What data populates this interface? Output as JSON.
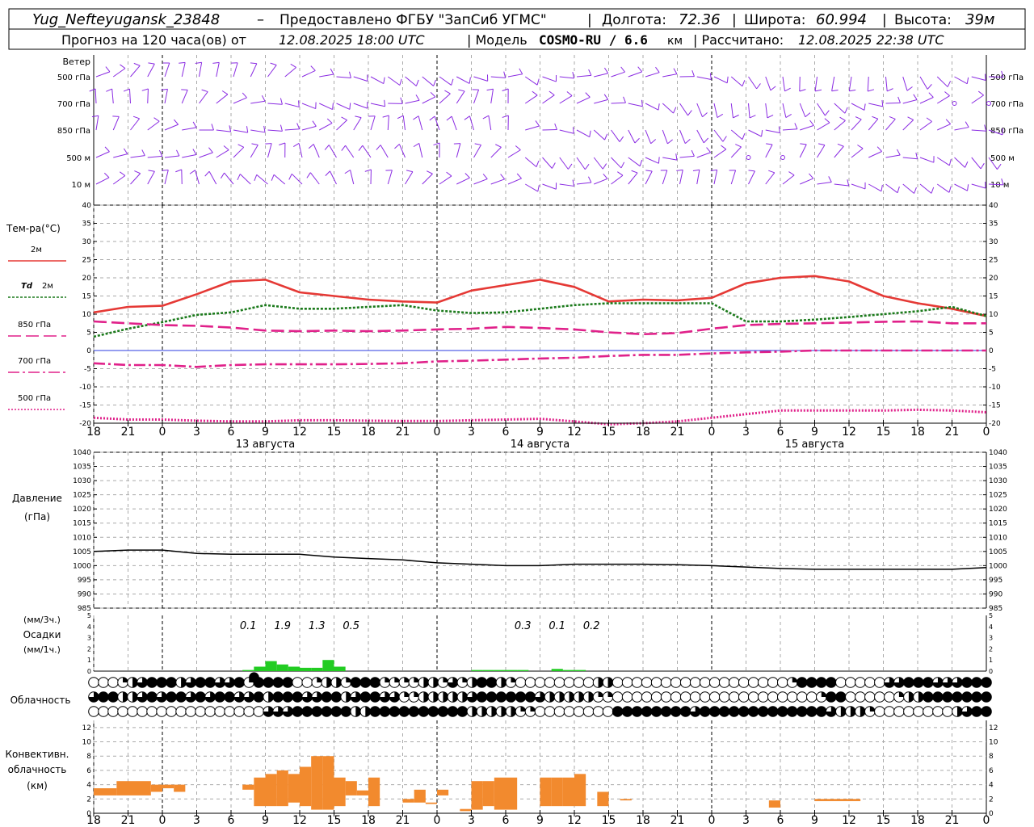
{
  "header": {
    "station": "Yug_Nefteyugansk_23848",
    "dash": "–",
    "provider": "Предоставлено ФГБУ \"ЗапСиб УГМС\"",
    "lon_label": "Долгота:",
    "lon": "72.36",
    "lat_label": "Широта:",
    "lat": "60.994",
    "alt_label": "Высота:",
    "alt": "39м",
    "forecast_label": "Прогноз на 120 часа(ов) от",
    "forecast_from": "12.08.2025 18:00 UTC",
    "model_label": "| Модель",
    "model": "COSMO-RU / 6.6",
    "model_unit": "км",
    "calc_label": "| Рассчитано:",
    "calc_time": "12.08.2025 22:38 UTC"
  },
  "time_axis": {
    "hour_labels": [
      "18",
      "21",
      "0",
      "3",
      "6",
      "9",
      "12",
      "15",
      "18",
      "21",
      "0",
      "3",
      "6",
      "9",
      "12",
      "15",
      "18",
      "21",
      "0",
      "3",
      "6",
      "9",
      "12",
      "15",
      "18",
      "21",
      "0"
    ],
    "day_labels": [
      {
        "label": "13 августа",
        "at_hour": 15
      },
      {
        "label": "14 августа",
        "at_hour": 39
      },
      {
        "label": "15 августа",
        "at_hour": 63
      }
    ],
    "day_boundaries_hours": [
      6,
      30,
      54,
      78
    ]
  },
  "wind_panel": {
    "title": "Ветер",
    "levels": [
      "500 гПа",
      "700 гПа",
      "850 гПа",
      "500 м",
      "10  м"
    ],
    "color": "#8a2be2"
  },
  "temperature": {
    "chart_data": {
      "type": "line",
      "title": "Тем-ра(°С)",
      "x": [
        0,
        3,
        6,
        9,
        12,
        15,
        18,
        21,
        24,
        27,
        30,
        33,
        36,
        39,
        42,
        45,
        48,
        51,
        54,
        57,
        60,
        63,
        66,
        69,
        72,
        75,
        78
      ],
      "ylim": [
        -20,
        40
      ],
      "yticks": [
        -20,
        -15,
        -10,
        -5,
        0,
        5,
        10,
        15,
        20,
        25,
        30,
        35,
        40
      ],
      "series": [
        {
          "name": "2м",
          "color": "#e53935",
          "dash": "",
          "values": [
            10.5,
            12,
            12.3,
            15.5,
            19,
            19.5,
            16,
            15,
            14,
            13.5,
            13.2,
            16.5,
            18,
            19.5,
            17.5,
            13.5,
            14,
            13.8,
            14.5,
            18.5,
            20,
            20.5,
            19,
            15,
            13,
            11.5,
            9.5
          ]
        },
        {
          "name": "Td 2м",
          "color": "#1b7a1b",
          "dash": "3,2",
          "values": [
            3.8,
            6,
            7.8,
            9.8,
            10.5,
            12.5,
            11.5,
            11.5,
            12,
            12.5,
            11,
            10.3,
            10.5,
            11.5,
            12.5,
            13,
            13,
            13,
            13,
            8,
            8,
            8.5,
            9.2,
            10,
            10.8,
            12,
            9.5
          ]
        },
        {
          "name": "850 гПа",
          "color": "#e0218a",
          "dash": "16,6",
          "values": [
            8,
            7.5,
            7,
            6.8,
            6.3,
            5.5,
            5.3,
            5.5,
            5.3,
            5.5,
            5.8,
            6,
            6.5,
            6.2,
            5.8,
            5,
            4.5,
            4.8,
            6,
            7,
            7.3,
            7.5,
            7.7,
            7.9,
            8,
            7.5,
            7.5
          ]
        },
        {
          "name": "700 гПа",
          "color": "#e0218a",
          "dash": "14,4,3,4",
          "values": [
            -3.5,
            -4,
            -4,
            -4.5,
            -4,
            -3.8,
            -3.8,
            -3.8,
            -3.7,
            -3.5,
            -3,
            -2.8,
            -2.5,
            -2.2,
            -2,
            -1.5,
            -1.2,
            -1.2,
            -0.8,
            -0.5,
            -0.3,
            0,
            0,
            0,
            0,
            0,
            0
          ]
        },
        {
          "name": "500 гПа",
          "color": "#e0218a",
          "dash": "2,2",
          "values": [
            -18.5,
            -19,
            -19,
            -19.3,
            -19.5,
            -19.5,
            -19.2,
            -19.2,
            -19.3,
            -19.4,
            -19.4,
            -19.2,
            -19,
            -18.8,
            -19.5,
            -20.3,
            -20,
            -19.5,
            -18.5,
            -17.5,
            -16.5,
            -16.5,
            -16.5,
            -16.5,
            -16.3,
            -16.5,
            -17
          ]
        }
      ],
      "zero_line_color": "#2b3be0"
    }
  },
  "pressure": {
    "title_line1": "Давление",
    "title_line2": "(гПа)",
    "chart_data": {
      "type": "line",
      "x": [
        0,
        3,
        6,
        9,
        12,
        15,
        18,
        21,
        24,
        27,
        30,
        33,
        36,
        39,
        42,
        45,
        48,
        51,
        54,
        57,
        60,
        63,
        66,
        69,
        72,
        75,
        78
      ],
      "ylim": [
        985,
        1040
      ],
      "yticks": [
        985,
        990,
        995,
        1000,
        1005,
        1010,
        1015,
        1020,
        1025,
        1030,
        1035,
        1040
      ],
      "series": [
        {
          "name": "",
          "color": "#000000",
          "values": [
            1005,
            1005.5,
            1005.5,
            1004.3,
            1004,
            1004,
            1004,
            1003,
            1002.5,
            1002,
            1001,
            1000.5,
            1000,
            1000,
            1000.5,
            1000.5,
            1000.5,
            1000.3,
            1000,
            999.5,
            999,
            998.7,
            998.7,
            998.7,
            998.7,
            998.7,
            999.3
          ]
        }
      ]
    }
  },
  "precipitation": {
    "title_line1": "(мм/3ч.)",
    "title_line2": "Осадки",
    "title_line3": "(мм/1ч.)",
    "totals": [
      {
        "label": "0.1",
        "at_hour": 13.5
      },
      {
        "label": "1.9",
        "at_hour": 16.5
      },
      {
        "label": "1.3",
        "at_hour": 19.5
      },
      {
        "label": "0.5",
        "at_hour": 22.5
      },
      {
        "label": "0.3",
        "at_hour": 37.5
      },
      {
        "label": "0.1",
        "at_hour": 40.5
      },
      {
        "label": "0.2",
        "at_hour": 43.5
      }
    ],
    "chart_data": {
      "type": "bar",
      "ylim": [
        0,
        5
      ],
      "yticks": [
        0,
        1,
        2,
        3,
        4,
        5
      ],
      "color": "#22cc22",
      "hours": [
        13,
        14,
        15,
        16,
        17,
        18,
        19,
        20,
        21,
        22,
        33,
        34,
        35,
        36,
        37,
        38,
        40,
        41,
        42
      ],
      "values": [
        0.1,
        0.4,
        0.9,
        0.6,
        0.4,
        0.3,
        0.3,
        1.0,
        0.4,
        0,
        0.1,
        0.1,
        0.1,
        0.1,
        0.1,
        0,
        0.2,
        0.1,
        0.1
      ]
    }
  },
  "cloudiness": {
    "title": "Облачность",
    "rows": [
      "000123444234433454444001221444111122131244210000000022000000000000000000144440000033444333444",
      "344223434434344334244433442344331122222344444432222211000000000000000000000144000001224444444",
      "000000000000000000333444444224444444444222221100000000444444443444444444444432221000000002344"
    ]
  },
  "convective": {
    "title_line1": "Конвективн.",
    "title_line2": "облачность",
    "title_line3": "(км)",
    "chart_data": {
      "type": "bar",
      "ylim": [
        0,
        13
      ],
      "yticks": [
        0,
        2,
        4,
        6,
        8,
        10,
        12
      ],
      "color": "#f28a2e",
      "segments": [
        {
          "h0": 0,
          "h1": 2,
          "base": 2.5,
          "top": 3.5
        },
        {
          "h0": 2,
          "h1": 5,
          "base": 2.5,
          "top": 4.5
        },
        {
          "h0": 5,
          "h1": 6,
          "base": 3,
          "top": 4
        },
        {
          "h0": 6,
          "h1": 7,
          "base": 3.5,
          "top": 4
        },
        {
          "h0": 7,
          "h1": 8,
          "base": 3,
          "top": 4
        },
        {
          "h0": 13,
          "h1": 14,
          "base": 3.3,
          "top": 4
        },
        {
          "h0": 14,
          "h1": 15,
          "base": 1,
          "top": 5
        },
        {
          "h0": 15,
          "h1": 16,
          "base": 1,
          "top": 5.5
        },
        {
          "h0": 16,
          "h1": 17,
          "base": 1,
          "top": 6
        },
        {
          "h0": 17,
          "h1": 18,
          "base": 1.5,
          "top": 5.5
        },
        {
          "h0": 18,
          "h1": 19,
          "base": 1,
          "top": 6.5
        },
        {
          "h0": 19,
          "h1": 20,
          "base": 0.5,
          "top": 8
        },
        {
          "h0": 20,
          "h1": 21,
          "base": 0.5,
          "top": 8
        },
        {
          "h0": 21,
          "h1": 22,
          "base": 1,
          "top": 5
        },
        {
          "h0": 22,
          "h1": 23,
          "base": 2.5,
          "top": 4.5
        },
        {
          "h0": 23,
          "h1": 24,
          "base": 2.5,
          "top": 3.2
        },
        {
          "h0": 24,
          "h1": 25,
          "base": 1,
          "top": 5
        },
        {
          "h0": 27,
          "h1": 28,
          "base": 1.5,
          "top": 2
        },
        {
          "h0": 28,
          "h1": 29,
          "base": 1.5,
          "top": 3.3
        },
        {
          "h0": 29,
          "h1": 30,
          "base": 1.3,
          "top": 1.5
        },
        {
          "h0": 30,
          "h1": 31,
          "base": 2.5,
          "top": 3.3
        },
        {
          "h0": 32,
          "h1": 33,
          "base": 0.3,
          "top": 0.6
        },
        {
          "h0": 33,
          "h1": 34,
          "base": 0.5,
          "top": 4.5
        },
        {
          "h0": 34,
          "h1": 35,
          "base": 1,
          "top": 4.5
        },
        {
          "h0": 35,
          "h1": 36,
          "base": 0.5,
          "top": 5
        },
        {
          "h0": 36,
          "h1": 37,
          "base": 0.5,
          "top": 5
        },
        {
          "h0": 39,
          "h1": 40,
          "base": 1,
          "top": 5
        },
        {
          "h0": 40,
          "h1": 41,
          "base": 1,
          "top": 5
        },
        {
          "h0": 41,
          "h1": 42,
          "base": 1,
          "top": 5
        },
        {
          "h0": 42,
          "h1": 43,
          "base": 1,
          "top": 5.5
        },
        {
          "h0": 44,
          "h1": 45,
          "base": 1,
          "top": 3
        },
        {
          "h0": 46,
          "h1": 47,
          "base": 1.8,
          "top": 2
        },
        {
          "h0": 59,
          "h1": 60,
          "base": 0.8,
          "top": 1.8
        },
        {
          "h0": 63,
          "h1": 67,
          "base": 1.7,
          "top": 2
        }
      ]
    }
  }
}
